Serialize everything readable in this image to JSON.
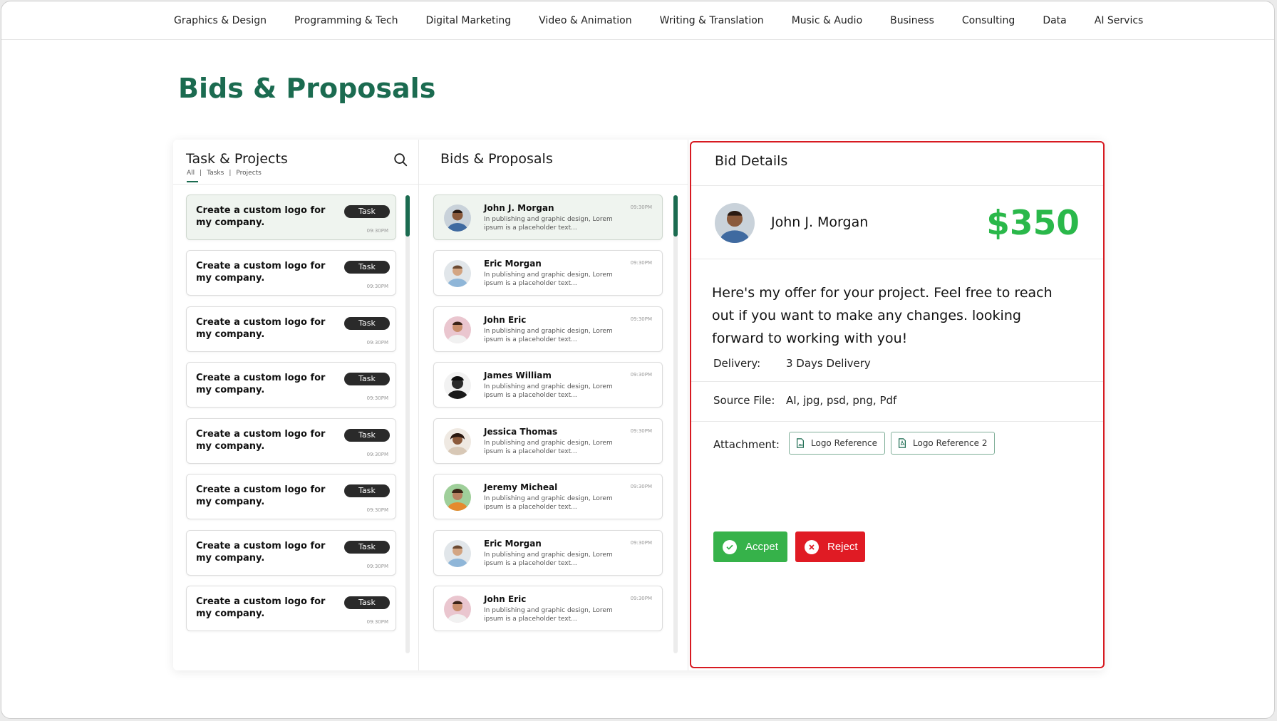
{
  "nav": {
    "items": [
      "Graphics & Design",
      "Programming & Tech",
      "Digital Marketing",
      "Video & Animation",
      "Writing & Translation",
      "Music & Audio",
      "Business",
      "Consulting",
      "Data",
      "AI Servics"
    ]
  },
  "page": {
    "title": "Bids & Proposals"
  },
  "tasks_panel": {
    "title": "Task & Projects",
    "filters": {
      "all": "All",
      "sep": "|",
      "tasks": "Tasks",
      "projects": "Projects"
    },
    "items": [
      {
        "title": "Create a custom logo for my company.",
        "badge": "Task",
        "time": "09:30PM"
      },
      {
        "title": "Create a custom logo for my company.",
        "badge": "Task",
        "time": "09:30PM"
      },
      {
        "title": "Create a custom logo for my company.",
        "badge": "Task",
        "time": "09:30PM"
      },
      {
        "title": "Create a custom logo for my company.",
        "badge": "Task",
        "time": "09:30PM"
      },
      {
        "title": "Create a custom logo for my company.",
        "badge": "Task",
        "time": "09:30PM"
      },
      {
        "title": "Create a custom logo for my company.",
        "badge": "Task",
        "time": "09:30PM"
      },
      {
        "title": "Create a custom logo for my company.",
        "badge": "Task",
        "time": "09:30PM"
      },
      {
        "title": "Create a custom logo for my company.",
        "badge": "Task",
        "time": "09:30PM"
      }
    ]
  },
  "bids_panel": {
    "title": "Bids & Proposals",
    "items": [
      {
        "name": "John J. Morgan",
        "snippet": "In publishing and graphic design, Lorem ipsum is a placeholder text...",
        "time": "09:30PM"
      },
      {
        "name": "Eric Morgan",
        "snippet": "In publishing and graphic design, Lorem ipsum is a placeholder text...",
        "time": "09:30PM"
      },
      {
        "name": "John Eric",
        "snippet": "In publishing and graphic design, Lorem ipsum is a placeholder text...",
        "time": "09:30PM"
      },
      {
        "name": "James William",
        "snippet": "In publishing and graphic design, Lorem ipsum is a placeholder text...",
        "time": "09:30PM"
      },
      {
        "name": "Jessica Thomas",
        "snippet": "In publishing and graphic design, Lorem ipsum is a placeholder text...",
        "time": "09:30PM"
      },
      {
        "name": "Jeremy Micheal",
        "snippet": "In publishing and graphic design, Lorem ipsum is a placeholder text...",
        "time": "09:30PM"
      },
      {
        "name": "Eric Morgan",
        "snippet": "In publishing and graphic design, Lorem ipsum is a placeholder text...",
        "time": "09:30PM"
      },
      {
        "name": "John Eric",
        "snippet": "In publishing and graphic design, Lorem ipsum is a placeholder text...",
        "time": "09:30PM"
      }
    ]
  },
  "details": {
    "title": "Bid Details",
    "bidder_name": "John J. Morgan",
    "price": "$350",
    "message": "Here's my offer for your project. Feel free to reach out if you want to make any changes. looking forward to working with you!",
    "delivery_label": "Delivery:",
    "delivery_value": "3 Days Delivery",
    "source_label": "Source File:",
    "source_value": "AI, jpg, psd, png, Pdf",
    "attachment_label": "Attachment:",
    "attachments": [
      "Logo Reference",
      "Logo Reference 2"
    ],
    "accept_label": "Accpet",
    "reject_label": "Reject"
  },
  "colors": {
    "brand_green": "#1b6b50",
    "price_green": "#2ab84a",
    "accept_green": "#36b24a",
    "reject_red": "#e01b24",
    "highlight_border": "#d71a21"
  }
}
